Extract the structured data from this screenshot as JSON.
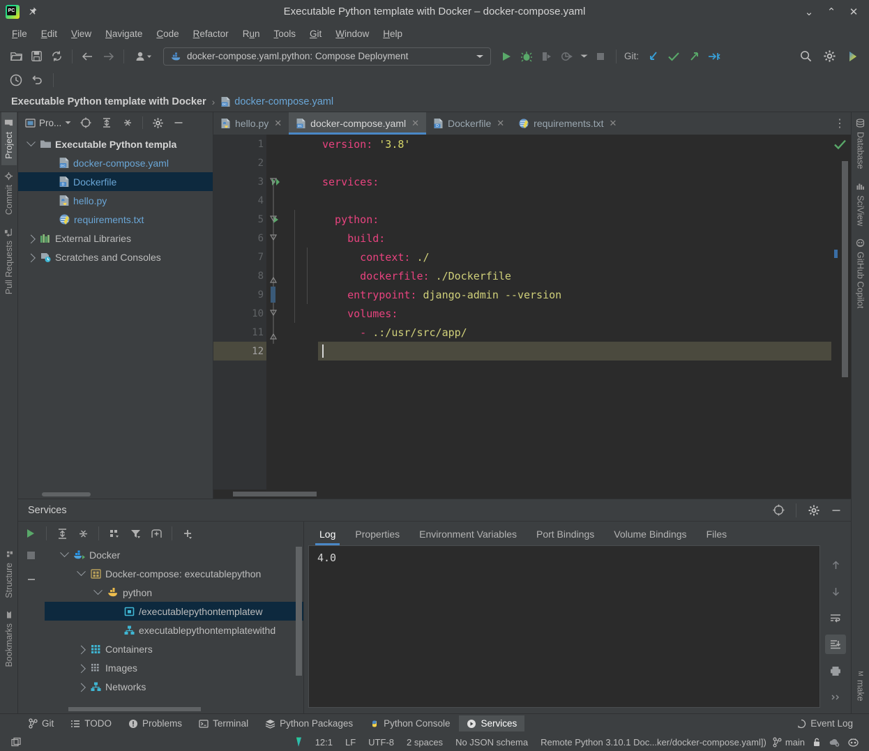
{
  "window": {
    "title": "Executable Python template with Docker – docker-compose.yaml",
    "minimize_label": "⌄",
    "maximize_label": "⌃",
    "close_label": "✕"
  },
  "menubar": {
    "items": [
      {
        "label": "File",
        "mnemonic": "F"
      },
      {
        "label": "Edit",
        "mnemonic": "E"
      },
      {
        "label": "View",
        "mnemonic": "V"
      },
      {
        "label": "Navigate",
        "mnemonic": "N"
      },
      {
        "label": "Code",
        "mnemonic": "C"
      },
      {
        "label": "Refactor",
        "mnemonic": "R"
      },
      {
        "label": "Run",
        "mnemonic": "u"
      },
      {
        "label": "Tools",
        "mnemonic": "T"
      },
      {
        "label": "Git",
        "mnemonic": "G"
      },
      {
        "label": "Window",
        "mnemonic": "W"
      },
      {
        "label": "Help",
        "mnemonic": "H"
      }
    ]
  },
  "toolbar": {
    "open_label": "Open",
    "save_label": "Save All",
    "sync_label": "Synchronize",
    "back_label": "Back",
    "forward_label": "Forward",
    "profile_label": "Profile",
    "run_config": "docker-compose.yaml.python: Compose Deployment",
    "run_label": "Run",
    "debug_label": "Debug",
    "run_coverage_label": "Run with Coverage",
    "profile_run_label": "Profile",
    "stop_label": "Stop",
    "git_label": "Git:",
    "git_update_label": "Update Project",
    "git_commit_label": "Commit",
    "git_push_label": "Push",
    "git_rollback_label": "Rollback",
    "search_label": "Search Everywhere",
    "settings_label": "Settings",
    "recent_label": "Recent Files",
    "undo_label": "Undo"
  },
  "navbar": {
    "project": "Executable Python template with Docker",
    "separator": "›",
    "file": "docker-compose.yaml"
  },
  "left_tool_window_bar": {
    "tabs": [
      {
        "label": "Project",
        "icon": "folder-icon",
        "active": true
      },
      {
        "label": "Commit",
        "icon": "commit-icon",
        "active": false
      },
      {
        "label": "Pull Requests",
        "icon": "pull-request-icon",
        "active": false
      }
    ],
    "bottom_tabs": [
      {
        "label": "Structure",
        "icon": "structure-icon"
      },
      {
        "label": "Bookmarks",
        "icon": "bookmark-icon"
      }
    ]
  },
  "right_tool_window_bar": {
    "tabs": [
      {
        "label": "Database",
        "icon": "database-icon"
      },
      {
        "label": "SciView",
        "icon": "sciview-icon"
      },
      {
        "label": "GitHub Copilot",
        "icon": "copilot-icon"
      }
    ],
    "bottom_tabs": [
      {
        "label": "make",
        "icon": "make-icon"
      }
    ]
  },
  "project_panel": {
    "title": "Pro...",
    "locate_label": "Select Opened File",
    "expand_label": "Expand All",
    "collapse_label": "Collapse All",
    "settings_label": "Options",
    "hide_label": "Hide",
    "tree": [
      {
        "label": "Executable Python templa",
        "kind": "root",
        "depth": 0,
        "expanded": true,
        "icon": "folder-icon",
        "selected": false
      },
      {
        "label": "docker-compose.yaml",
        "kind": "file",
        "depth": 1,
        "icon": "docker-compose-file-icon",
        "selected": false
      },
      {
        "label": "Dockerfile",
        "kind": "file",
        "depth": 1,
        "icon": "dockerfile-icon",
        "selected": true
      },
      {
        "label": "hello.py",
        "kind": "file",
        "depth": 1,
        "icon": "python-file-icon",
        "selected": false
      },
      {
        "label": "requirements.txt",
        "kind": "file",
        "depth": 1,
        "icon": "requirements-file-icon",
        "selected": false
      },
      {
        "label": "External Libraries",
        "kind": "plain",
        "depth": 0,
        "expanded": false,
        "icon": "library-icon",
        "selected": false
      },
      {
        "label": "Scratches and Consoles",
        "kind": "plain",
        "depth": 0,
        "expanded": false,
        "icon": "scratches-icon",
        "selected": false
      }
    ]
  },
  "editor": {
    "tabs": [
      {
        "label": "hello.py",
        "icon": "python-file-icon",
        "active": false,
        "close": "✕"
      },
      {
        "label": "docker-compose.yaml",
        "icon": "docker-compose-file-icon",
        "active": true,
        "close": "✕"
      },
      {
        "label": "Dockerfile",
        "icon": "dockerfile-icon",
        "active": false,
        "close": "✕"
      },
      {
        "label": "requirements.txt",
        "icon": "requirements-file-icon",
        "active": false,
        "close": "✕"
      }
    ],
    "more_tabs_label": "⋮",
    "inspection_status": "✔",
    "current_line": 12,
    "lines": [
      {
        "num": "1",
        "segments": [
          {
            "t": "version:",
            "c": "k"
          },
          {
            "t": " ",
            "c": "punct"
          },
          {
            "t": "'3.8'",
            "c": "s"
          }
        ],
        "indent": 0,
        "gutter_icon": "",
        "fold": ""
      },
      {
        "num": "2",
        "segments": [],
        "indent": 0,
        "gutter_icon": "",
        "fold": ""
      },
      {
        "num": "3",
        "segments": [
          {
            "t": "services:",
            "c": "k"
          }
        ],
        "indent": 0,
        "gutter_icon": "run-all-icon",
        "fold": "collapse"
      },
      {
        "num": "4",
        "segments": [],
        "indent": 0,
        "gutter_icon": "",
        "fold": ""
      },
      {
        "num": "5",
        "segments": [
          {
            "t": "  python:",
            "c": "k"
          }
        ],
        "indent": 1,
        "gutter_icon": "run-icon",
        "fold": "collapse"
      },
      {
        "num": "6",
        "segments": [
          {
            "t": "    build:",
            "c": "k"
          }
        ],
        "indent": 2,
        "gutter_icon": "",
        "fold": "collapse"
      },
      {
        "num": "7",
        "segments": [
          {
            "t": "      context:",
            "c": "k"
          },
          {
            "t": " ",
            "c": "punct"
          },
          {
            "t": "./",
            "c": "v"
          }
        ],
        "indent": 3,
        "gutter_icon": "",
        "fold": ""
      },
      {
        "num": "8",
        "segments": [
          {
            "t": "      dockerfile:",
            "c": "k"
          },
          {
            "t": " ",
            "c": "punct"
          },
          {
            "t": "./Dockerfile",
            "c": "v"
          }
        ],
        "indent": 3,
        "gutter_icon": "",
        "fold": "end"
      },
      {
        "num": "9",
        "segments": [
          {
            "t": "    entrypoint:",
            "c": "k"
          },
          {
            "t": " ",
            "c": "punct"
          },
          {
            "t": "django-admin --version",
            "c": "v"
          }
        ],
        "indent": 2,
        "gutter_icon": "",
        "fold": "change"
      },
      {
        "num": "10",
        "segments": [
          {
            "t": "    volumes:",
            "c": "k"
          }
        ],
        "indent": 2,
        "gutter_icon": "",
        "fold": "collapse"
      },
      {
        "num": "11",
        "segments": [
          {
            "t": "      - ",
            "c": "k"
          },
          {
            "t": ".:/usr/src/app/",
            "c": "v"
          }
        ],
        "indent": 3,
        "gutter_icon": "",
        "fold": "end"
      },
      {
        "num": "12",
        "segments": [],
        "indent": 0,
        "gutter_icon": "",
        "fold": "",
        "caret": true
      }
    ]
  },
  "services_panel": {
    "title": "Services",
    "settings_label": "Settings",
    "hide_label": "Hide",
    "target_label": "Select Target",
    "toolbar": {
      "run_label": "Run",
      "stop_label": "Stop",
      "hide_label": "Hide",
      "expand_label": "Expand All",
      "collapse_label": "Collapse All",
      "group_label": "Group",
      "filter_label": "Filter",
      "add_tab_label": "Add Tab",
      "add_label": "Add Service"
    },
    "tree": [
      {
        "label": "Docker",
        "depth": 0,
        "expanded": true,
        "icon": "docker-running-icon",
        "selected": false
      },
      {
        "label": "Docker-compose: executablepython",
        "depth": 1,
        "expanded": true,
        "icon": "compose-icon",
        "selected": false
      },
      {
        "label": "python",
        "depth": 2,
        "expanded": true,
        "icon": "docker-whale-icon",
        "selected": false
      },
      {
        "label": "/executablepythontemplatew",
        "depth": 3,
        "expanded": null,
        "icon": "container-icon",
        "selected": true
      },
      {
        "label": "executablepythontemplatewithd",
        "depth": 3,
        "expanded": null,
        "icon": "network-icon",
        "selected": false
      },
      {
        "label": "Containers",
        "depth": 1,
        "expanded": false,
        "icon": "containers-icon",
        "selected": false
      },
      {
        "label": "Images",
        "depth": 1,
        "expanded": false,
        "icon": "images-icon",
        "selected": false
      },
      {
        "label": "Networks",
        "depth": 1,
        "expanded": false,
        "icon": "network-icon",
        "selected": false
      }
    ],
    "detail_tabs": [
      {
        "label": "Log",
        "active": true
      },
      {
        "label": "Properties",
        "active": false
      },
      {
        "label": "Environment Variables",
        "active": false
      },
      {
        "label": "Port Bindings",
        "active": false
      },
      {
        "label": "Volume Bindings",
        "active": false
      },
      {
        "label": "Files",
        "active": false
      }
    ],
    "log_text": "4.0",
    "log_tools": [
      {
        "name": "up-icon",
        "label": "Previous Occurrence",
        "active": false
      },
      {
        "name": "down-icon",
        "label": "Next Occurrence",
        "active": false
      },
      {
        "name": "soft-wrap-icon",
        "label": "Soft-Wrap",
        "active": false
      },
      {
        "name": "scroll-to-end-icon",
        "label": "Scroll to End",
        "active": true
      },
      {
        "name": "print-icon",
        "label": "Print",
        "active": false
      },
      {
        "name": "overflow-icon",
        "label": "More",
        "active": false
      }
    ]
  },
  "bottom_bar": {
    "items": [
      {
        "label": "Git",
        "icon": "git-icon",
        "active": false
      },
      {
        "label": "TODO",
        "icon": "todo-icon",
        "active": false
      },
      {
        "label": "Problems",
        "icon": "problems-icon",
        "active": false
      },
      {
        "label": "Terminal",
        "icon": "terminal-icon",
        "active": false
      },
      {
        "label": "Python Packages",
        "icon": "packages-icon",
        "active": false
      },
      {
        "label": "Python Console",
        "icon": "python-console-icon",
        "active": false
      },
      {
        "label": "Services",
        "icon": "services-icon",
        "active": true
      }
    ],
    "event_log": {
      "label": "Event Log",
      "icon": "event-log-icon"
    }
  },
  "status_bar": {
    "caret_position": "12:1",
    "line_separator": "LF",
    "encoding": "UTF-8",
    "indent": "2 spaces",
    "schema": "No JSON schema",
    "interpreter": "Remote Python 3.10.1 Doc...ker/docker-compose.yaml])",
    "branch": "main",
    "branch_icon": "git-branch-icon",
    "lock_icon": "lock-icon",
    "cloud_icon": "cloud-icon",
    "copilot_icon": "copilot-status-icon",
    "inspection_icon": "inspections-widget",
    "memory_icon": "memory-indicator"
  },
  "colors": {
    "accent_blue": "#4a88c7",
    "selection_blue": "#0d293e",
    "editor_bg": "#2b2b2b",
    "panel_bg": "#3c3f41",
    "gutter_bg": "#313335",
    "key_pink": "#e8437f",
    "value_yellow": "#d0d07a",
    "link_blue": "#6aa6d6",
    "green": "#59a869",
    "current_line": "#4b4a3e"
  }
}
